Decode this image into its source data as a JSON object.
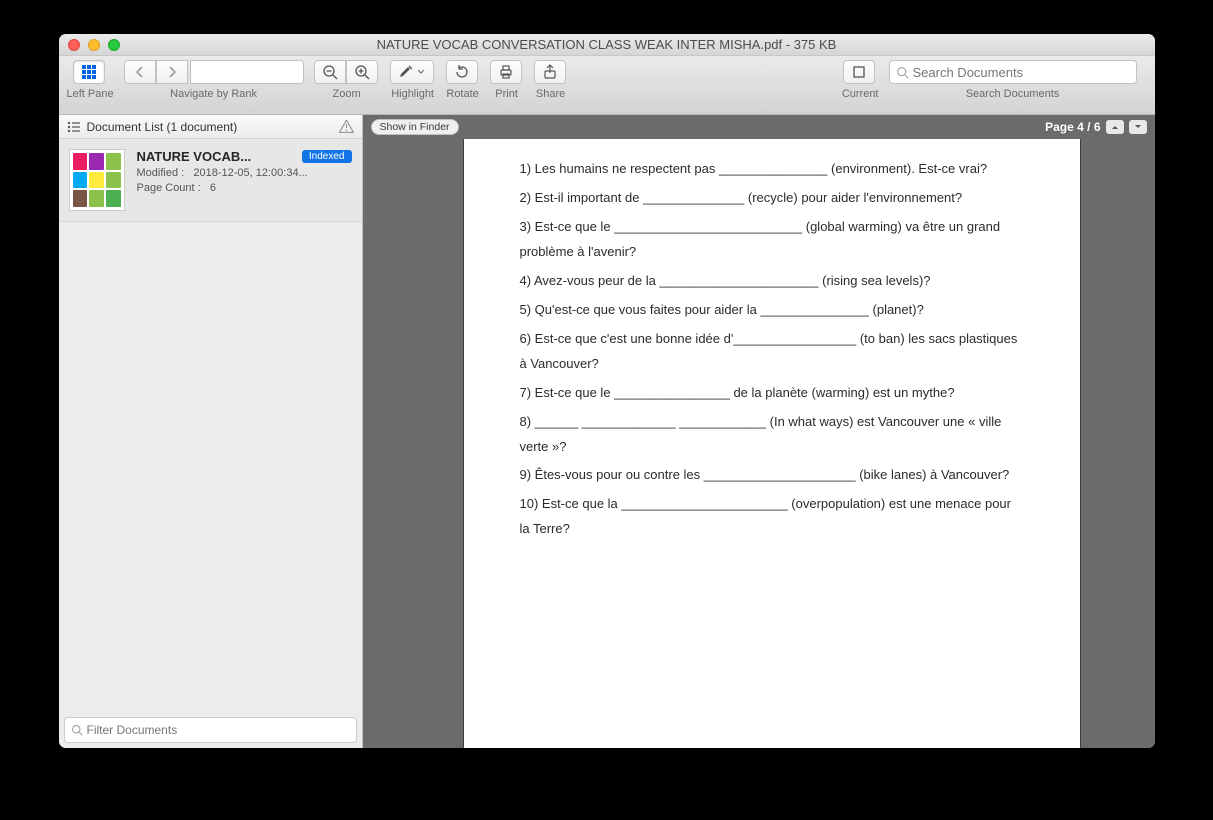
{
  "window": {
    "title": "NATURE VOCAB CONVERSATION CLASS WEAK INTER MISHA.pdf - 375 KB"
  },
  "toolbar": {
    "left_pane": "Left Pane",
    "navigate": "Navigate by Rank",
    "zoom": "Zoom",
    "highlight": "Highlight",
    "rotate": "Rotate",
    "print": "Print",
    "share": "Share",
    "current": "Current",
    "search_documents": "Search Documents",
    "search_placeholder": "Search Documents"
  },
  "sidebar": {
    "header": "Document List (1 document)",
    "filter_placeholder": "Filter Documents",
    "doc": {
      "title": "NATURE VOCAB...",
      "badge": "Indexed",
      "modified_label": "Modified :",
      "modified_value": "2018-12-05, 12:00:34...",
      "pagecount_label": "Page Count :",
      "pagecount_value": "6"
    }
  },
  "viewer": {
    "show_in_finder": "Show in Finder",
    "page_indicator": "Page 4 / 6"
  },
  "document": {
    "paragraphs": [
      "1) Les humains ne respectent pas _______________ (environment). Est-ce vrai?",
      "2) Est-il important de ______________ (recycle) pour aider l'environnement?",
      "3) Est-ce que le __________________________ (global warming) va être un grand problème à l'avenir?",
      "4) Avez-vous peur de la ______________________ (rising sea levels)?",
      "5) Qu'est-ce que vous faites pour aider la _______________ (planet)?",
      "6) Est-ce que c'est une bonne idée d'_________________ (to ban) les sacs plastiques à Vancouver?",
      "7) Est-ce que le ________________ de la planète (warming) est un mythe?",
      "8) ______ _____________ ____________ (In what ways) est Vancouver une « ville verte »?",
      "9) Êtes-vous pour ou contre les _____________________ (bike lanes) à Vancouver?",
      "10) Est-ce que la _______________________ (overpopulation) est une menace pour la Terre?"
    ]
  }
}
